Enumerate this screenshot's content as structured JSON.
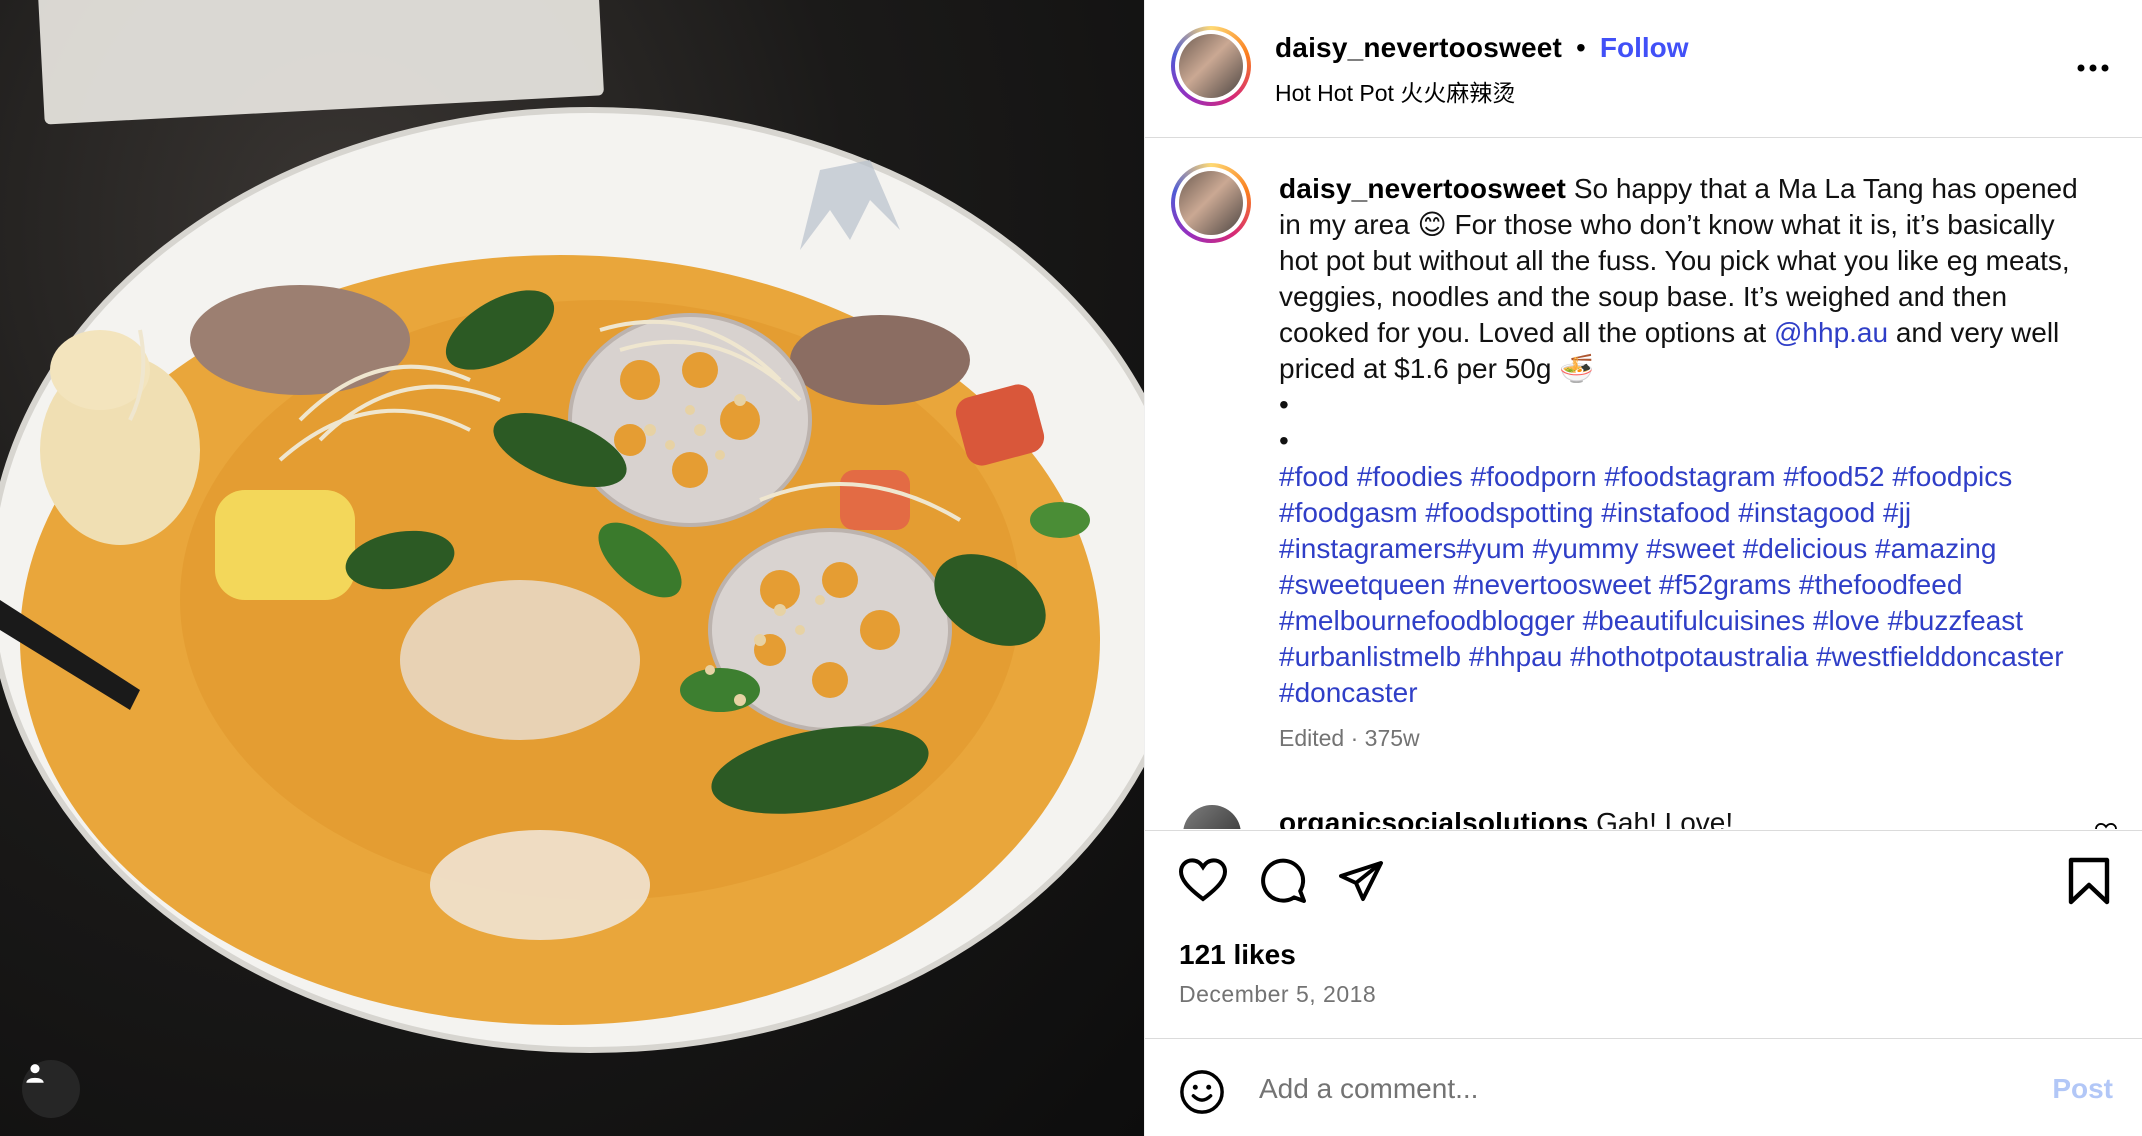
{
  "photo": {
    "alt_icon": "user-tag-icon"
  },
  "header": {
    "username": "daisy_nevertoosweet",
    "separator": "•",
    "follow_label": "Follow",
    "location": "Hot Hot Pot 火火麻辣烫"
  },
  "caption": {
    "username": "daisy_nevertoosweet",
    "text_part1": " So happy that a Ma La Tang has opened in my area 😊 For those who don’t know what it is, it’s basically hot pot but without all the fuss. You pick what you like eg meats, veggies, noodles and the soup base. It’s weighed and then cooked for you. Loved all the options at ",
    "mention": "@hhp.au",
    "text_part2": " and very well priced at $1.6 per 50g 🍜",
    "bullets": [
      "•",
      "•"
    ],
    "hashtags": [
      "#food",
      "#foodies",
      "#foodporn",
      "#foodstagram",
      "#food52",
      "#foodpics",
      "#foodgasm",
      "#foodspotting",
      "#instafood",
      "#instagood",
      "#jj",
      "#instagramers#yum",
      "#yummy",
      "#sweet",
      "#delicious",
      "#amazing",
      "#sweetqueen",
      "#nevertoosweet",
      "#f52grams",
      "#thefoodfeed",
      "#melbournefoodblogger",
      "#beautifulcuisines",
      "#love",
      "#buzzfeast",
      "#urbanlistmelb",
      "#hhpau",
      "#hothotpotaustralia",
      "#westfielddoncaster",
      "#doncaster"
    ],
    "meta": "Edited · 375w"
  },
  "comment": {
    "username": "organicsocialsolutions",
    "text": " Gah! Love!"
  },
  "actions": {
    "likes": "121 likes",
    "date": "December 5, 2018"
  },
  "add_comment": {
    "placeholder": "Add a comment...",
    "post_label": "Post"
  },
  "colors": {
    "link_blue": "#4150f7",
    "hashtag_blue": "#2f3ec7",
    "muted_gray": "#737373",
    "post_disabled": "#b2c7f7",
    "border": "#dbdbdb"
  }
}
